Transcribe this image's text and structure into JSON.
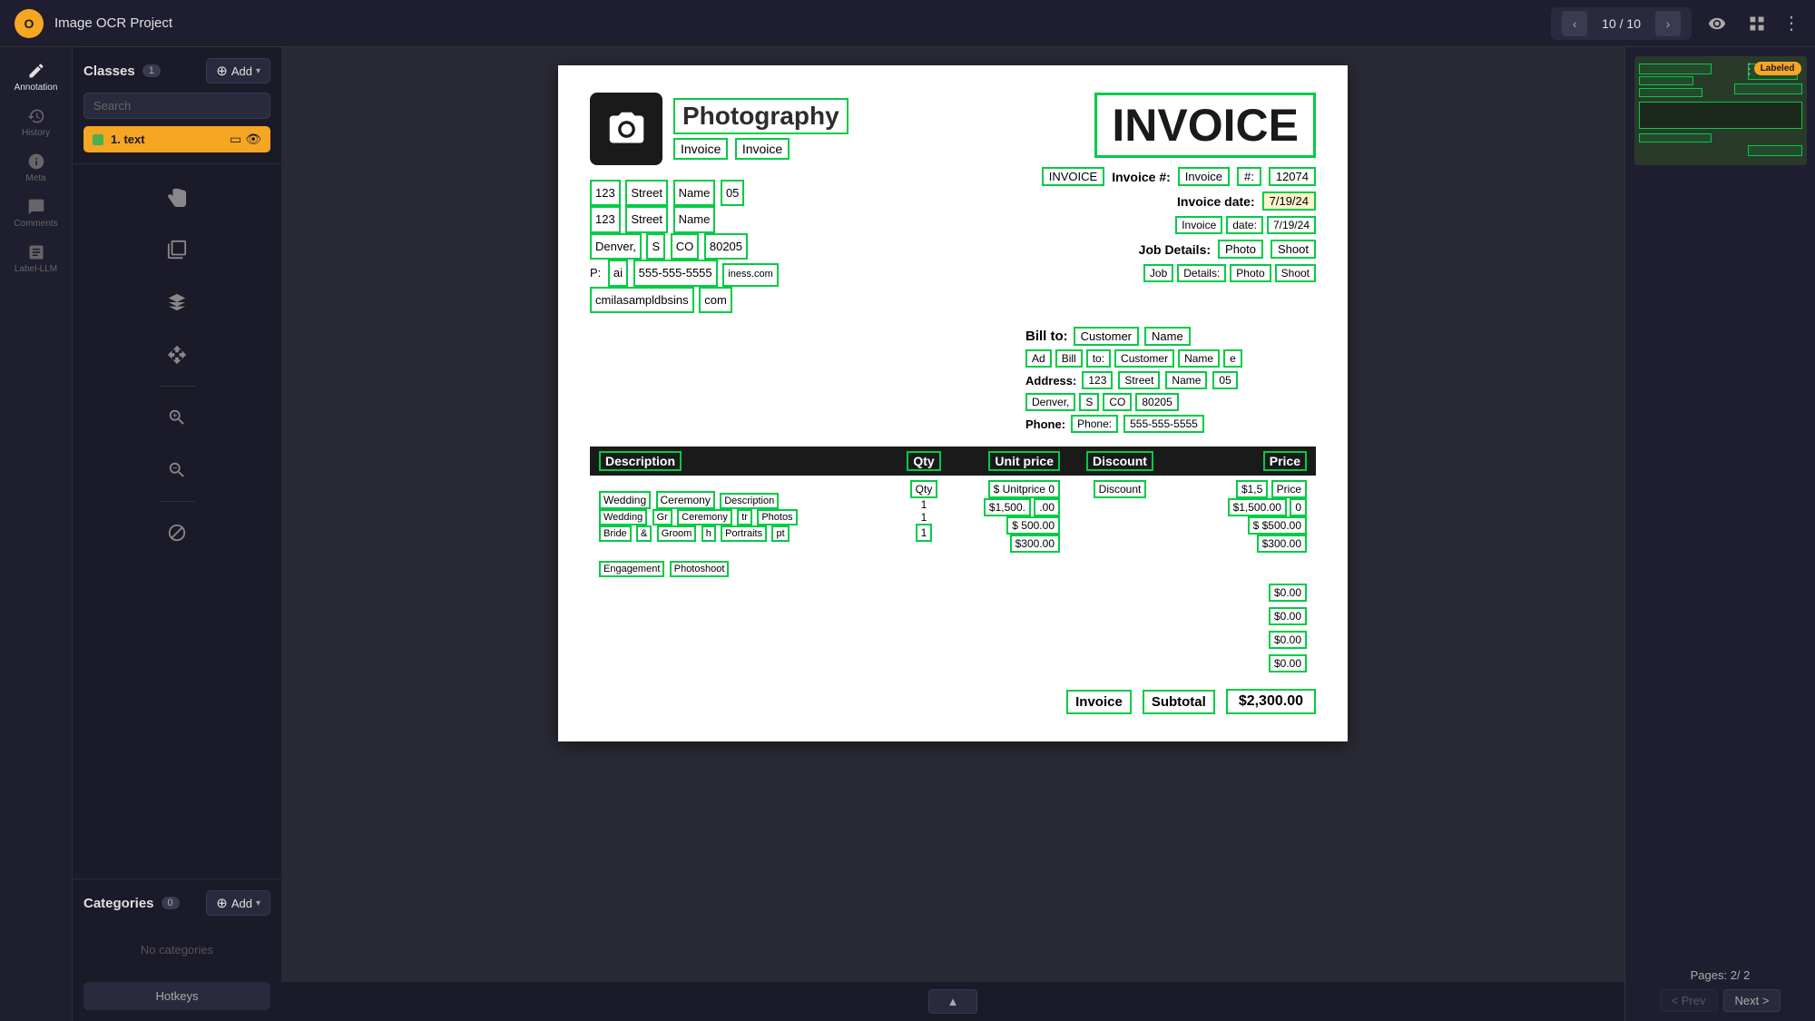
{
  "app": {
    "title": "Image OCR Project",
    "logo": "O"
  },
  "navigation": {
    "prev_arrow": "‹",
    "next_arrow": "›",
    "current_page": "10",
    "total_pages": "10",
    "page_display": "10 / 10"
  },
  "topbar": {
    "eye_icon": "👁",
    "grid_icon": "⊞",
    "menu_icon": "⋮"
  },
  "sidebar": {
    "classes_label": "Classes",
    "classes_count": "1",
    "add_label": "Add",
    "search_placeholder": "Search",
    "class_item": {
      "name": "1. text",
      "color": "#4caf50"
    },
    "categories_label": "Categories",
    "categories_count": "0",
    "no_categories_text": "No categories",
    "hotkeys_label": "Hotkeys"
  },
  "toolbar_items": [
    {
      "id": "annotation",
      "label": "Annotation"
    },
    {
      "id": "history",
      "label": "History"
    },
    {
      "id": "meta",
      "label": "Meta"
    },
    {
      "id": "comments",
      "label": "Comments"
    },
    {
      "id": "label-llm",
      "label": "Label-LLM"
    }
  ],
  "tools": [
    {
      "id": "hand",
      "label": ""
    },
    {
      "id": "select",
      "label": ""
    },
    {
      "id": "polygon",
      "label": ""
    },
    {
      "id": "transform",
      "label": ""
    },
    {
      "id": "zoom-in",
      "label": ""
    },
    {
      "id": "zoom-out",
      "label": ""
    },
    {
      "id": "zoom-reset",
      "label": ""
    },
    {
      "id": "disable",
      "label": ""
    }
  ],
  "invoice": {
    "title": "INVOICE",
    "company_name": "Photography",
    "invoice_word": "Invoice",
    "invoice_num_label": "Invoice #:",
    "invoice_num": "12074",
    "invoice_date_label": "Invoice date:",
    "invoice_date": "7/19/24",
    "job_details_label": "Job Details:",
    "job_details": "Photo Shoot",
    "bill_to_label": "Bill to:",
    "customer_name": "Customer Name",
    "address_label": "Address:",
    "address_line1": "123 Street Name 05",
    "address_city": "Denver, S CO 80205",
    "phone_label": "Phone:",
    "customer_phone": "555-555-5555",
    "vendor_address1": "123 Street Name",
    "vendor_address2": "Denver, S CO 80205",
    "vendor_phone_label": "P:",
    "vendor_phone": "555-555-5555",
    "vendor_email": "cmilasampldbsins.com",
    "table": {
      "columns": [
        "Description",
        "Qty",
        "Unit price",
        "Discount",
        "Price"
      ],
      "rows": [
        {
          "description": "Wedding Ceremony & Groom + Bride Photos",
          "qty": "1",
          "unit_price": "$1,500.00",
          "discount": "",
          "price": "$1,500.00"
        },
        {
          "description": "Bride & Groom Portraits",
          "qty": "1",
          "unit_price": "$500.00",
          "discount": "",
          "price": "$500.00"
        },
        {
          "description": "Engagement Photoshoot",
          "qty": "1",
          "unit_price": "$300.00",
          "discount": "",
          "price": "$300.00"
        },
        {
          "description": "",
          "qty": "",
          "unit_price": "",
          "discount": "",
          "price": "$0.00"
        },
        {
          "description": "",
          "qty": "",
          "unit_price": "",
          "discount": "",
          "price": "$0.00"
        },
        {
          "description": "",
          "qty": "",
          "unit_price": "",
          "discount": "",
          "price": "$0.00"
        },
        {
          "description": "",
          "qty": "",
          "unit_price": "",
          "discount": "",
          "price": "$0.00"
        }
      ],
      "subtotal_label": "Invoice Subtotal",
      "subtotal": "$2,300.00"
    }
  },
  "thumbnail": {
    "labeled_badge": "Labeled",
    "more_icon": "⋮"
  },
  "pages": {
    "label": "Pages:",
    "current": "2",
    "total": "2",
    "display": "2/ 2",
    "prev_label": "< Prev",
    "next_label": "Next >"
  }
}
